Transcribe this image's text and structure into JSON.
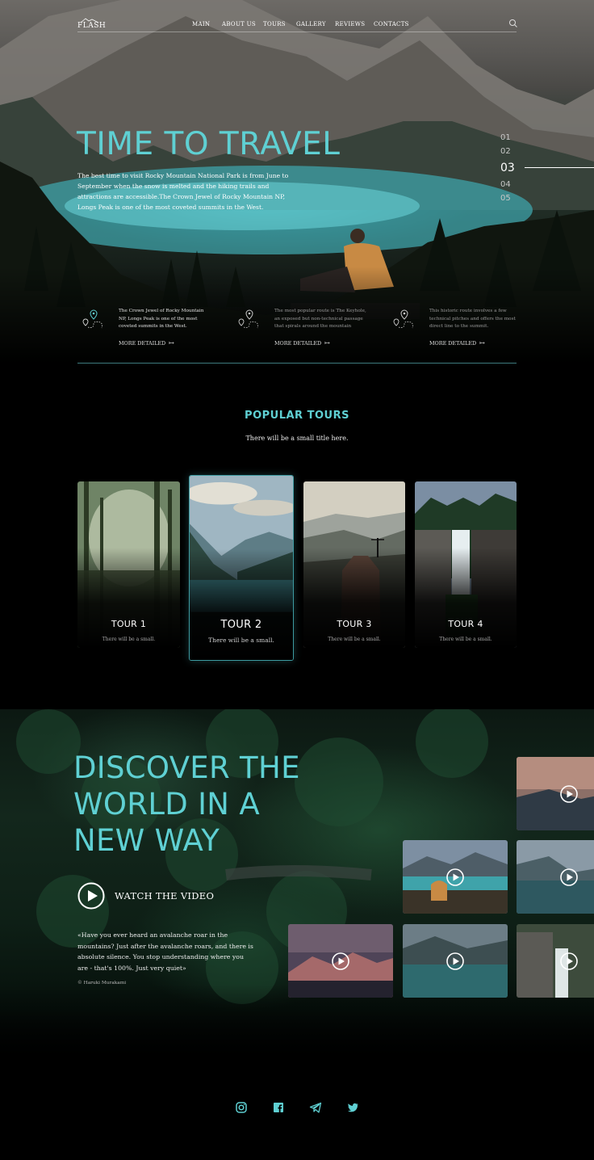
{
  "brand": {
    "logo_text": "FLASH"
  },
  "nav": {
    "items": [
      "MAIN",
      "ABOUT US",
      "TOURS",
      "GALLERY",
      "REVIEWS",
      "CONTACTS"
    ]
  },
  "hero": {
    "title": "TIME TO TRAVEL",
    "text": "The best time to visit Rocky Mountain National Park is from June to September when the snow is melted and the hiking trails and attractions are accessible.The Crown Jewel of Rocky Mountain NP, Longs Peak is one of the most coveted summits in the West.",
    "slides": [
      "01",
      "02",
      "03",
      "04",
      "05"
    ],
    "active_slide": "03"
  },
  "features": [
    {
      "text": "The Crown Jewel of Rocky Mountain NP, Longs Peak is one of the most coveted summits in the West.",
      "link": "MORE DETAILED",
      "icon": "route-pin-icon"
    },
    {
      "text": "The most popular route is The Keyhole, an exposed but non-technical passage that spirals around the mountain",
      "link": "MORE DETAILED",
      "icon": "route-pin-icon"
    },
    {
      "text": "This historic route involves a few technical pitches and offers the most direct line to the summit.",
      "link": "MORE DETAILED",
      "icon": "route-pin-icon"
    }
  ],
  "tours": {
    "title": "POPULAR TOURS",
    "subtitle": "There will be a small title here.",
    "cards": [
      {
        "name": "TOUR 1",
        "desc": "There will be a small."
      },
      {
        "name": "TOUR 2",
        "desc": "There will be a small."
      },
      {
        "name": "TOUR 3",
        "desc": "There will be a small."
      },
      {
        "name": "TOUR 4",
        "desc": "There will be a small."
      }
    ]
  },
  "discover": {
    "title_lines": [
      "DISCOVER THE",
      "WORLD IN A",
      "NEW WAY"
    ],
    "watch_label": "WATCH THE VIDEO",
    "quote": "«Have you ever heard an avalanche roar in the mountains? Just after the avalanche roars, and there is absolute silence. You stop understanding where you are - that's 100%. Just very quiet»",
    "author": "© Haruki Murakami"
  },
  "social": [
    "instagram-icon",
    "facebook-icon",
    "telegram-icon",
    "twitter-icon"
  ],
  "colors": {
    "accent": "#5fd0d3",
    "background": "#000000"
  }
}
